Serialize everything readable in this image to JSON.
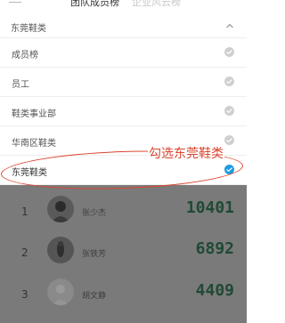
{
  "header": {
    "tabs": [
      {
        "label": "团队成员榜",
        "active": true
      },
      {
        "label": "企业风云榜",
        "active": false
      }
    ]
  },
  "dropdown": {
    "title": "东莞鞋类",
    "options": [
      {
        "label": "成员榜",
        "selected": false
      },
      {
        "label": "员工",
        "selected": false
      },
      {
        "label": "鞋类事业部",
        "selected": false
      },
      {
        "label": "华南区鞋类",
        "selected": false
      },
      {
        "label": "东莞鞋类",
        "selected": true
      }
    ]
  },
  "annotation": {
    "text": "勾选东莞鞋类",
    "color": "#d9452f"
  },
  "ranking": [
    {
      "rank": "1",
      "name": "张少杰",
      "score": "10401"
    },
    {
      "rank": "2",
      "name": "张铁芳",
      "score": "6892"
    },
    {
      "rank": "3",
      "name": "胡文静",
      "score": "4409"
    }
  ],
  "colors": {
    "accent": "#1e9be3",
    "score": "#1f4a34",
    "overlay": "#7a7a7a"
  }
}
